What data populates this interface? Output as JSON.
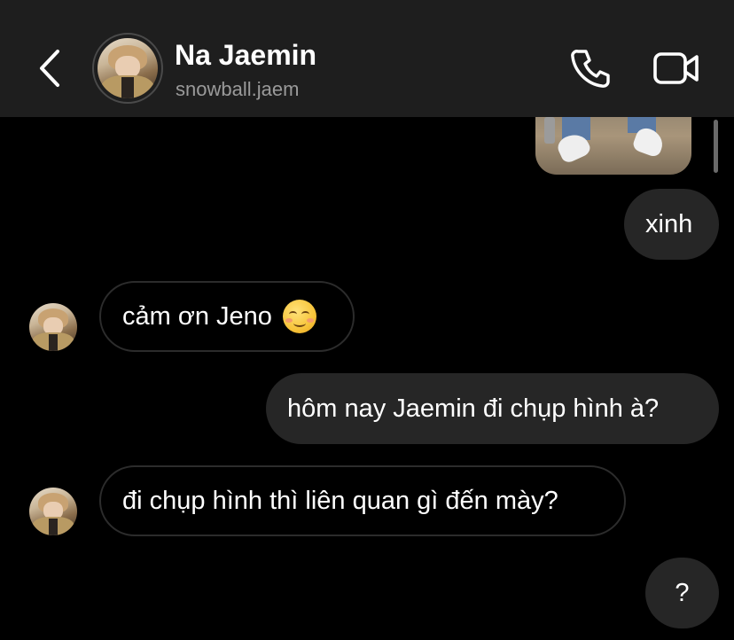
{
  "header": {
    "name": "Na Jaemin",
    "username": "snowball.jaem"
  },
  "icons": {
    "back": "chevron-left-icon",
    "call": "phone-icon",
    "video": "video-camera-icon",
    "emoji": "smiling-face-with-smiling-eyes"
  },
  "colors": {
    "header_bg": "#1e1e1e",
    "chat_bg": "#000000",
    "sent_bubble": "#262626",
    "received_border": "#2c2c2c",
    "username": "#9a9a9a"
  },
  "messages": [
    {
      "sender": "me",
      "type": "photo"
    },
    {
      "sender": "me",
      "text": "xinh"
    },
    {
      "sender": "contact",
      "text": "cảm ơn Jeno",
      "emoji": "☺️"
    },
    {
      "sender": "me",
      "text": "hôm nay Jaemin đi chụp hình à?"
    },
    {
      "sender": "contact",
      "text": "đi chụp hình thì liên quan gì đến mày?"
    },
    {
      "sender": "me",
      "text": "?"
    }
  ]
}
